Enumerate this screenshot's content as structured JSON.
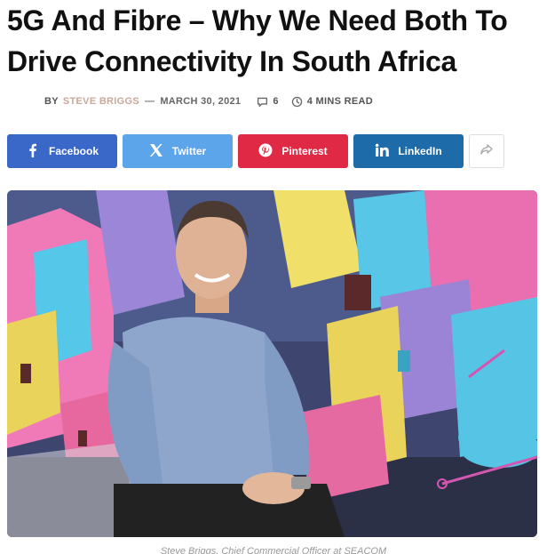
{
  "article": {
    "title": "5G And Fibre – Why We Need Both To Drive Connectivity In South Africa",
    "meta": {
      "by": "BY",
      "author": "STEVE BRIGGS",
      "separator": "—",
      "date": "MARCH 30, 2021",
      "comments": "6",
      "read_time": "4 MINS READ"
    },
    "caption": "Steve Briggs, Chief Commercial Officer at SEACOM"
  },
  "share": {
    "facebook": "Facebook",
    "twitter": "Twitter",
    "pinterest": "Pinterest",
    "linkedin": "LinkedIn"
  },
  "icons": {
    "facebook": "facebook-icon",
    "twitter": "x-twitter-icon",
    "pinterest": "pinterest-icon",
    "linkedin": "linkedin-icon",
    "more": "share-arrow-icon",
    "comments": "comment-bubble-icon",
    "clock": "clock-icon"
  },
  "colors": {
    "facebook": "#3a68c9",
    "twitter": "#5ca5ea",
    "pinterest": "#e02a45",
    "linkedin": "#1d6ba8",
    "author": "#c9a89a"
  }
}
